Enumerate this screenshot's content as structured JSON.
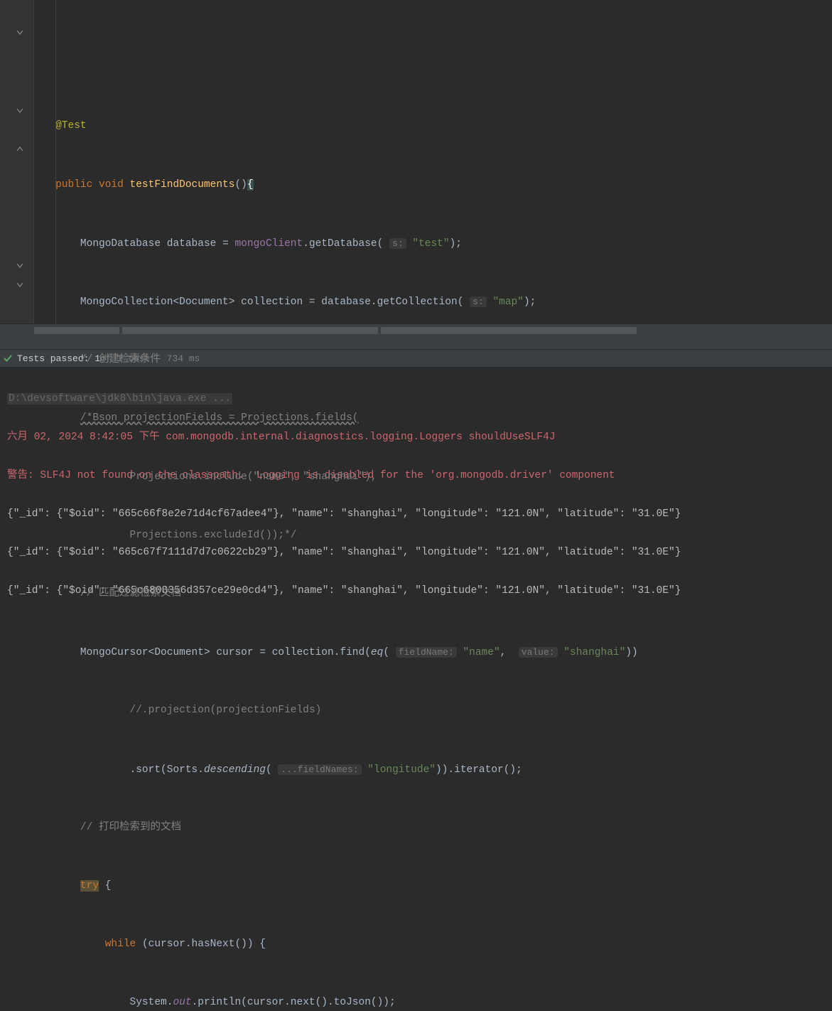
{
  "code": {
    "annotation": "@Test",
    "method_mods": "public void",
    "method_name": "testFindDocuments",
    "db_type": "MongoDatabase",
    "db_var": "database",
    "client_var": "mongoClient",
    "get_db": "getDatabase",
    "hint_s": "s:",
    "str_test": "\"test\"",
    "coll_type": "MongoCollection<Document>",
    "coll_var": "collection",
    "get_coll": "getCollection",
    "str_map": "\"map\"",
    "cmt1": "// 创建检索条件",
    "cmt_block1": "/*Bson projectionFields = Projections.fields(",
    "cmt_block2": "Projections.include(\"name\", \"shanghai\"),",
    "cmt_block3": "Projections.excludeId());*/",
    "cmt2": "// 匹配过滤检索文档",
    "cursor_type": "MongoCursor<Document>",
    "cursor_var": "cursor",
    "find_call": "collection.find",
    "eq_fn": "eq",
    "hint_field": "fieldName:",
    "str_name": "\"name\"",
    "hint_value": "value:",
    "str_shanghai": "\"shanghai\"",
    "cmt_proj": "//.projection(projectionFields)",
    "sort_call": ".sort(Sorts.",
    "desc_fn": "descending",
    "hint_fields": "...fieldNames:",
    "str_long": "\"longitude\"",
    "iter_call": ")).iterator();",
    "cmt3": "// 打印检索到的文档",
    "try_kw": "try",
    "while_kw": "while",
    "while_cond": "(cursor.hasNext()) {",
    "print1": "System.",
    "print_out": "out",
    "print2": ".println(cursor.next().toJson());"
  },
  "test": {
    "passed_label": "Tests passed: 1",
    "meta": " of 1 test – 734 ms"
  },
  "console": {
    "cmd": "D:\\devsoftware\\jdk8\\bin\\java.exe ...",
    "log1": "六月 02, 2024 8:42:05 下午 com.mongodb.internal.diagnostics.logging.Loggers shouldUseSLF4J",
    "log2": "警告: SLF4J not found on the classpath.  Logging is disabled for the 'org.mongodb.driver' component",
    "out1": "{\"_id\": {\"$oid\": \"665c66f8e2e71d4cf67adee4\"}, \"name\": \"shanghai\", \"longitude\": \"121.0N\", \"latitude\": \"31.0E\"}",
    "out2": "{\"_id\": {\"$oid\": \"665c67f7111d7d7c0622cb29\"}, \"name\": \"shanghai\", \"longitude\": \"121.0N\", \"latitude\": \"31.0E\"}",
    "out3": "{\"_id\": {\"$oid\": \"665c6808356d357ce29e0cd4\"}, \"name\": \"shanghai\", \"longitude\": \"121.0N\", \"latitude\": \"31.0E\"}"
  }
}
